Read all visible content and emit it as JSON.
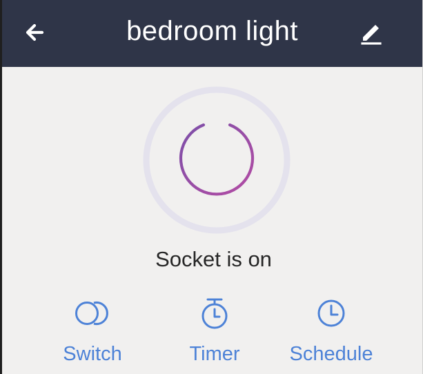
{
  "header": {
    "title": "bedroom light",
    "back_icon": "back-arrow-icon",
    "edit_icon": "pencil-icon"
  },
  "status": {
    "text": "Socket is on",
    "power_icon": "power-icon"
  },
  "actions": [
    {
      "label": "Switch",
      "icon": "switch-icon"
    },
    {
      "label": "Timer",
      "icon": "timer-icon"
    },
    {
      "label": "Schedule",
      "icon": "clock-icon"
    }
  ],
  "colors": {
    "header_background": "#2f3548",
    "content_background": "#f1f0ef",
    "power_gradient_start": "#7d4fa8",
    "power_gradient_end": "#b34ca4",
    "action_blue": "#4d82d7"
  }
}
